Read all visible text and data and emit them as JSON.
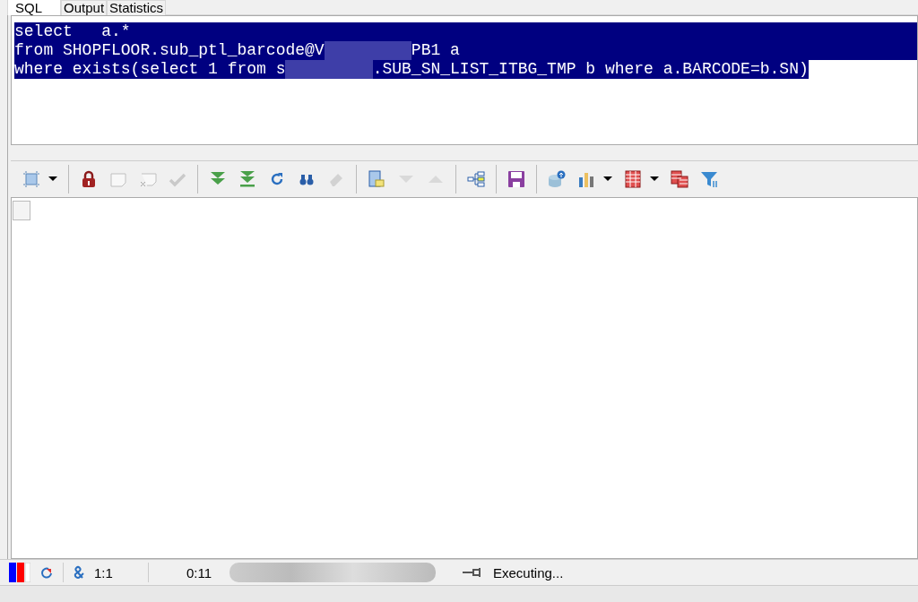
{
  "tabs": [
    {
      "label": "SQL",
      "selected": true
    },
    {
      "label": "Output",
      "selected": false
    },
    {
      "label": "Statistics",
      "selected": false
    }
  ],
  "editor": {
    "lines": [
      [
        {
          "text": "select   a.*"
        }
      ],
      [
        {
          "text": "from SHOPFLOOR.sub_ptl_barcode@V"
        },
        {
          "kind": "redacted"
        },
        {
          "text": "PB1 a"
        }
      ],
      [
        {
          "text": "where exists(select 1 from s"
        },
        {
          "kind": "redacted"
        },
        {
          "text": ".SUB_SN_LIST_ITBG_TMP b where a.BARCODE=b.SN)"
        }
      ]
    ],
    "selected": true
  },
  "toolbar": [
    {
      "kind": "select-cells",
      "disabled": false
    },
    {
      "kind": "caret",
      "disabled": false
    },
    {
      "kind": "sep"
    },
    {
      "kind": "lock",
      "disabled": false
    },
    {
      "kind": "new-row",
      "disabled": true
    },
    {
      "kind": "delete-row",
      "disabled": true
    },
    {
      "kind": "check",
      "disabled": true
    },
    {
      "kind": "sep"
    },
    {
      "kind": "fetch-next",
      "disabled": false
    },
    {
      "kind": "fetch-all",
      "disabled": false
    },
    {
      "kind": "refresh",
      "disabled": false
    },
    {
      "kind": "find",
      "disabled": false
    },
    {
      "kind": "eraser",
      "disabled": true
    },
    {
      "kind": "sep"
    },
    {
      "kind": "record",
      "disabled": false
    },
    {
      "kind": "down",
      "disabled": true
    },
    {
      "kind": "up",
      "disabled": true
    },
    {
      "kind": "sep"
    },
    {
      "kind": "tree",
      "disabled": false
    },
    {
      "kind": "sep"
    },
    {
      "kind": "save",
      "disabled": false
    },
    {
      "kind": "sep"
    },
    {
      "kind": "db-export",
      "disabled": false
    },
    {
      "kind": "chart",
      "disabled": false
    },
    {
      "kind": "caret",
      "disabled": false
    },
    {
      "kind": "table",
      "disabled": false
    },
    {
      "kind": "caret",
      "disabled": false
    },
    {
      "kind": "tables",
      "disabled": false
    },
    {
      "kind": "filter",
      "disabled": false
    }
  ],
  "status_bar": {
    "position": "1:1",
    "elapsed": "0:11",
    "state": "Executing..."
  }
}
